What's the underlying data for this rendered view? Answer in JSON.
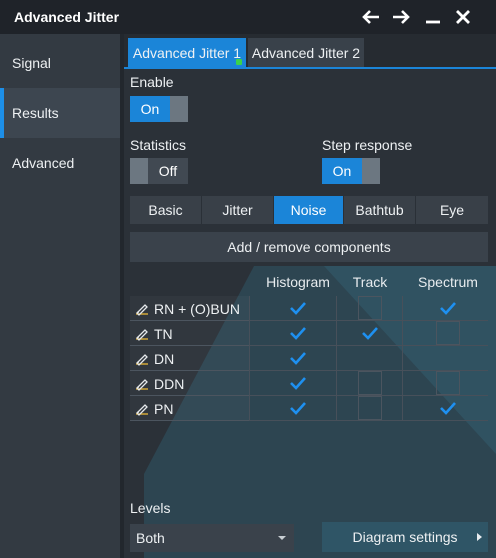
{
  "window": {
    "title": "Advanced Jitter"
  },
  "sidebar": {
    "items": [
      {
        "label": "Signal"
      },
      {
        "label": "Results"
      },
      {
        "label": "Advanced"
      }
    ]
  },
  "tabs": [
    {
      "label": "Advanced Jitter 1"
    },
    {
      "label": "Advanced Jitter 2"
    }
  ],
  "enable": {
    "label": "Enable",
    "value": "On"
  },
  "statistics": {
    "label": "Statistics",
    "value": "Off"
  },
  "step_response": {
    "label": "Step response",
    "value": "On"
  },
  "segments": [
    {
      "label": "Basic"
    },
    {
      "label": "Jitter"
    },
    {
      "label": "Noise"
    },
    {
      "label": "Bathtub"
    },
    {
      "label": "Eye"
    }
  ],
  "add_remove_label": "Add / remove components",
  "table": {
    "columns": [
      "Histogram",
      "Track",
      "Spectrum"
    ],
    "rows": [
      {
        "name": "RN + (O)BUN",
        "histogram": true,
        "track": false,
        "spectrum": true
      },
      {
        "name": "TN",
        "histogram": true,
        "track": true,
        "spectrum": false
      },
      {
        "name": "DN",
        "histogram": true,
        "track": null,
        "spectrum": null
      },
      {
        "name": "DDN",
        "histogram": true,
        "track": false,
        "spectrum": false
      },
      {
        "name": "PN",
        "histogram": true,
        "track": false,
        "spectrum": true
      }
    ]
  },
  "levels": {
    "label": "Levels",
    "value": "Both"
  },
  "diagram_settings_label": "Diagram settings",
  "colors": {
    "accent": "#1b85d8",
    "check": "#1e90f0",
    "active_dot": "#3ad24a"
  }
}
